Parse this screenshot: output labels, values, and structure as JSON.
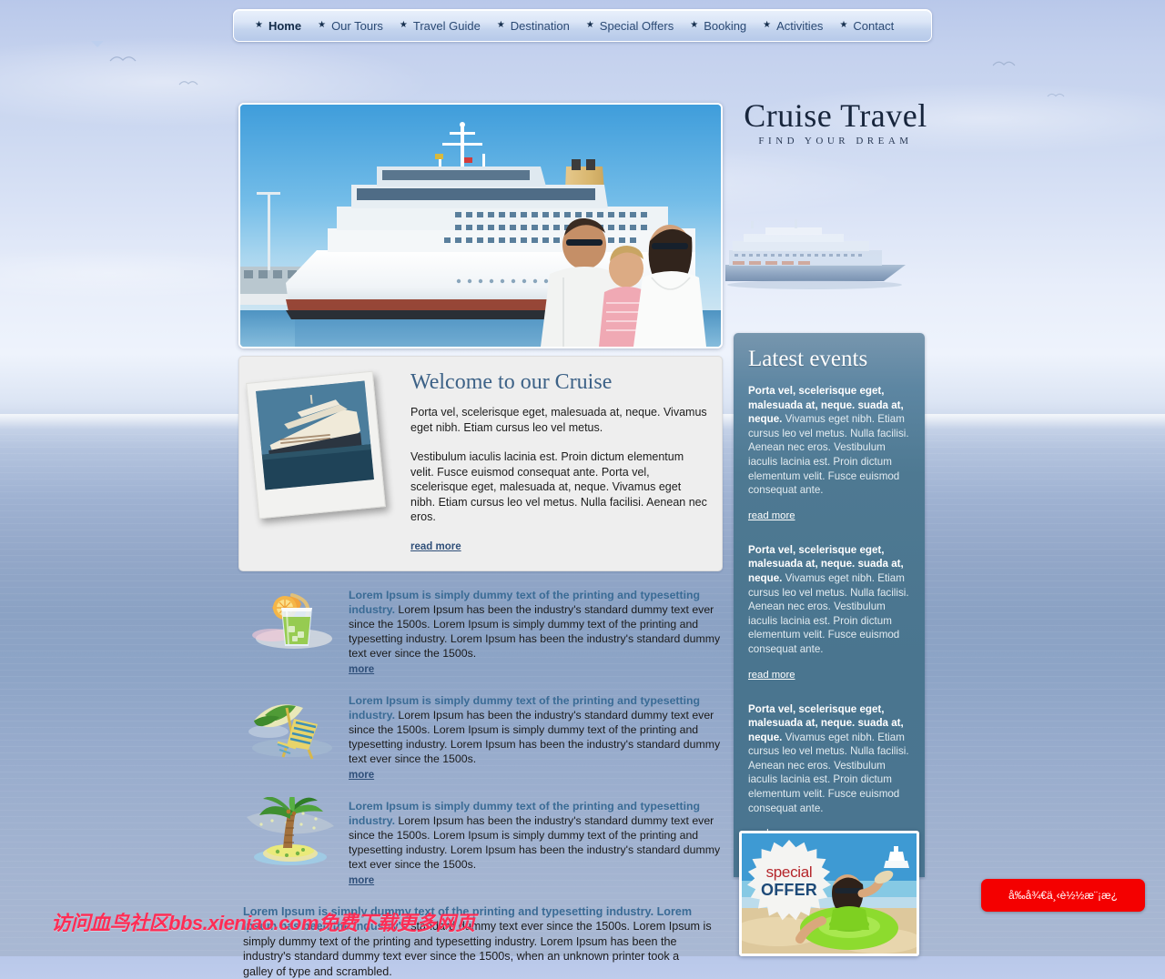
{
  "nav": {
    "items": [
      {
        "label": "Home",
        "active": true
      },
      {
        "label": "Our Tours",
        "active": false
      },
      {
        "label": "Travel Guide",
        "active": false
      },
      {
        "label": "Destination",
        "active": false
      },
      {
        "label": "Special Offers",
        "active": false
      },
      {
        "label": "Booking",
        "active": false
      },
      {
        "label": "Activities",
        "active": false
      },
      {
        "label": "Contact",
        "active": false
      }
    ]
  },
  "logo": {
    "title": "Cruise Travel",
    "tagline": "FIND YOUR DREAM"
  },
  "welcome": {
    "title": "Welcome to our Cruise",
    "paragraph1": "Porta vel, scelerisque eget, malesuada at, neque. Vivamus eget nibh. Etiam cursus leo vel metus.",
    "paragraph2": "Vestibulum iaculis lacinia est. Proin dictum elementum velit. Fusce euismod consequat ante. Porta vel, scelerisque eget, malesuada at, neque. Vivamus eget nibh. Etiam cursus leo vel metus. Nulla facilisi. Aenean nec eros.",
    "read_more": "read more"
  },
  "features": [
    {
      "icon": "cocktail-drink-icon",
      "lead": "Lorem Ipsum is simply dummy text of the printing and typesetting industry.",
      "body": " Lorem Ipsum has been the industry's standard dummy text ever since the 1500s. Lorem Ipsum is simply dummy text of the printing and typesetting industry. Lorem Ipsum has been the industry's standard dummy text ever since the 1500s.",
      "more": "more"
    },
    {
      "icon": "beach-umbrella-chair-icon",
      "lead": "Lorem Ipsum is simply dummy text of the printing and typesetting industry.",
      "body": " Lorem Ipsum has been the industry's standard dummy text ever since the 1500s. Lorem Ipsum is simply dummy text of the printing and typesetting industry. Lorem Ipsum has been the industry's standard dummy text ever since the 1500s.",
      "more": "more"
    },
    {
      "icon": "palm-island-icon",
      "lead": "Lorem Ipsum is simply dummy text of the printing and typesetting industry.",
      "body": " Lorem Ipsum has been the industry's standard dummy text ever since the 1500s. Lorem Ipsum is simply dummy text of the printing and typesetting industry. Lorem Ipsum has been the industry's standard dummy text ever since the 1500s.",
      "more": "more"
    }
  ],
  "bottom_block": {
    "lead": "Lorem Ipsum is simply dummy text of the printing and typesetting industry. Lorem Ipsum has been the industry's",
    "body": " standard dummy text ever since the 1500s. Lorem Ipsum is simply dummy text of the printing and typesetting industry. Lorem Ipsum has been the industry's standard dummy text ever since the 1500s, when an unknown printer took a galley of type and scrambled."
  },
  "sidebar": {
    "title": "Latest events",
    "events": [
      {
        "lead": "Porta vel, scelerisque eget, malesuada at, neque. suada at, neque.",
        "body": " Vivamus eget nibh. Etiam cursus leo vel metus. Nulla facilisi. Aenean nec eros. Vestibulum iaculis lacinia est. Proin dictum elementum velit. Fusce euismod consequat ante.",
        "read_more": "read more"
      },
      {
        "lead": "Porta vel, scelerisque eget, malesuada at, neque. suada at, neque.",
        "body": " Vivamus eget nibh. Etiam cursus leo vel metus. Nulla facilisi. Aenean nec eros. Vestibulum iaculis lacinia est. Proin dictum elementum velit. Fusce euismod consequat ante.",
        "read_more": "read more"
      },
      {
        "lead": "Porta vel, scelerisque eget, malesuada at, neque. suada at, neque.",
        "body": " Vivamus eget nibh. Etiam cursus leo vel metus. Nulla facilisi. Aenean nec eros. Vestibulum iaculis lacinia est. Proin dictum elementum velit. Fusce euismod consequat ante.",
        "read_more": "read more"
      }
    ]
  },
  "offer": {
    "badge_top": "special",
    "badge_bottom": "OFFER"
  },
  "watermark": {
    "text": "访问血鸟社区bbs.xieniao.com免费下载更多网页"
  },
  "floating_button": {
    "label": "å‰å¾€ä¸‹è½½æ¨¡æ¿"
  },
  "colors": {
    "accent_blue": "#3a6b95",
    "link_blue": "#2f4f79",
    "sidebar_bg": "#4e7992",
    "offer_red": "#b5252a",
    "offer_navy": "#1e4a78",
    "watermark_red": "#ff2d55",
    "button_red": "#f40000"
  }
}
